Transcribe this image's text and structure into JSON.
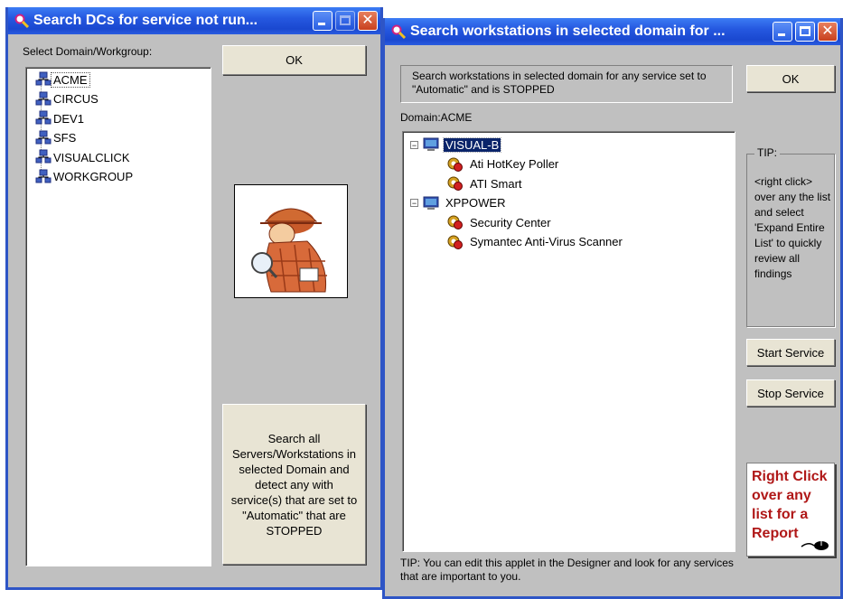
{
  "left_window": {
    "title": "Search DCs for service not run...",
    "select_label": "Select Domain/Workgroup:",
    "ok_label": "OK",
    "domains": [
      "ACME",
      "CIRCUS",
      "DEV1",
      "SFS",
      "VISUALCLICK",
      "WORKGROUP"
    ],
    "search_all_label": "Search all Servers/Workstations in selected Domain and detect any with service(s) that are set to \"Automatic\" that are STOPPED"
  },
  "right_window": {
    "title": "Search workstations in selected domain for ...",
    "description": "Search workstations in selected domain for any service set to \"Automatic\" and is STOPPED",
    "ok_label": "OK",
    "domain_label": "Domain:ACME",
    "tree": [
      {
        "computer": "VISUAL-B",
        "services": [
          "Ati HotKey Poller",
          "ATI Smart"
        ]
      },
      {
        "computer": "XPPOWER",
        "services": [
          "Security Center",
          "Symantec Anti-Virus Scanner"
        ]
      }
    ],
    "tip_title": "TIP:",
    "tip_body": "<right click> over any the list and select 'Expand Entire List' to quickly review all findings",
    "start_service_label": "Start Service",
    "stop_service_label": "Stop Service",
    "report_badge": "Right Click over any list for a Report",
    "footer_tip": "TIP: You can edit this applet in the Designer and look for any services that are important to you."
  },
  "colors": {
    "titlebar": "#2558e0",
    "window_bg": "#c0c0c0",
    "selection": "#0a246a",
    "report_text": "#b01818"
  }
}
